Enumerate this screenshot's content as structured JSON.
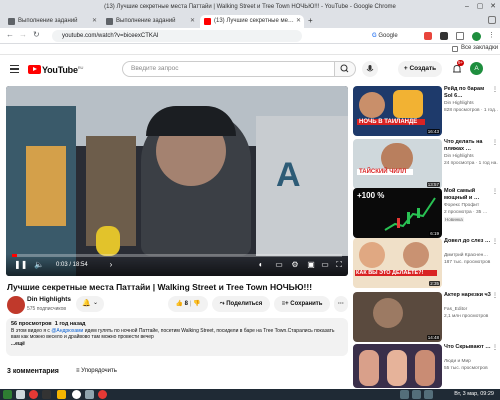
{
  "window": {
    "title": "(13) Лучшие секретные места Паттайи | Walking Street и Tree Town НОЧЬЮ!!! - YouTube - Google Chrome"
  },
  "tabs": [
    {
      "label": "Выполнение заданий",
      "active": false
    },
    {
      "label": "Выполнение заданий",
      "active": false
    },
    {
      "label": "(13) Лучшие секретные ме…",
      "active": true
    }
  ],
  "browser": {
    "url": "youtube.com/watch?v=biceexCTKAI",
    "bookmarks_label": "Все закладки"
  },
  "youtube": {
    "logo": "YouTube",
    "logo_region": "RU",
    "search_placeholder": "Введите запрос",
    "create_label": "Создать",
    "notification_count": "9+",
    "avatar_letter": "A"
  },
  "player": {
    "time": "0:03 / 18:54",
    "progress": 0.003
  },
  "video": {
    "title": "Лучшие секретные места Паттайи | Walking Street и Tree Town НОЧЬЮ!!!",
    "channel": "Din Highlights",
    "subscribers": "575 подписчиков",
    "likes": "8",
    "share_label": "Поделиться",
    "save_label": "Сохранить",
    "more_label": "···",
    "views": "56 просмотров",
    "date": "1 год назад",
    "description_prefix": "В этом видео я с ",
    "description_mention": "@Андрюхами",
    "description_rest": " идем гулять по ночной Паттайе, посетим Walking Street, посидели в баре на Tree Town.Старались показать вам как можно весело и драйвово там можно провести вечер",
    "more_text": "...ещё"
  },
  "comments": {
    "count_label": "3 комментария",
    "sort_label": "Упорядочить"
  },
  "recommendations": [
    {
      "title": "Рейд по барам Sol 6…",
      "channel": "Din Highlights",
      "meta": "828 просмотров · 1 год…",
      "duration": "16:43",
      "thumb_text": "НОЧЬ В ТАИЛАНДЕ",
      "badge": ""
    },
    {
      "title": "Что делать на пляжах …",
      "channel": "Din Highlights",
      "meta": "24 просмотра · 1 год на…",
      "duration": "13:57",
      "thumb_text": "ТАЙСКИЙ ЧИЛЛ",
      "badge": ""
    },
    {
      "title": "Мой самый мощный и …",
      "channel": "Форекс Профит",
      "meta": "2 просмотра · 35 …",
      "duration": "6:19",
      "thumb_text": "+100 %",
      "badge": "Новинка"
    },
    {
      "title": "Довел до слез …",
      "channel": "Дмитрий Краснен…",
      "meta": "187 тыс. просмотров",
      "duration": "2:35",
      "thumb_text": "КАК ВЫ ЭТО ДЕЛАЕТЕ?!",
      "badge": ""
    },
    {
      "title": "Актер нарезки ч3",
      "channel": "Fas_Editor",
      "meta": "2,1 млн просмотров",
      "duration": "14:48",
      "thumb_text": "",
      "badge": ""
    },
    {
      "title": "Что Скрывают …",
      "channel": "Люди и Мир",
      "meta": "55 тыс. просмотров",
      "duration": "",
      "thumb_text": "",
      "badge": ""
    }
  ],
  "taskbar": {
    "clock": "Вт, 3 мар, 09:29"
  },
  "colors": {
    "youtube_red": "#ff0000",
    "progress_red": "#ff0000",
    "link_blue": "#065fd4",
    "avatar_green": "#1e8e3e"
  }
}
